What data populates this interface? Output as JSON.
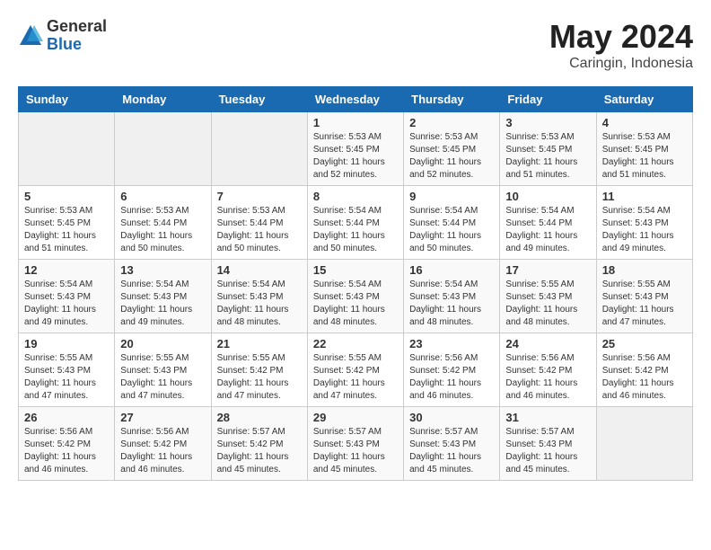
{
  "logo": {
    "general": "General",
    "blue": "Blue"
  },
  "title": "May 2024",
  "location": "Caringin, Indonesia",
  "days_header": [
    "Sunday",
    "Monday",
    "Tuesday",
    "Wednesday",
    "Thursday",
    "Friday",
    "Saturday"
  ],
  "weeks": [
    [
      {
        "day": "",
        "info": ""
      },
      {
        "day": "",
        "info": ""
      },
      {
        "day": "",
        "info": ""
      },
      {
        "day": "1",
        "info": "Sunrise: 5:53 AM\nSunset: 5:45 PM\nDaylight: 11 hours\nand 52 minutes."
      },
      {
        "day": "2",
        "info": "Sunrise: 5:53 AM\nSunset: 5:45 PM\nDaylight: 11 hours\nand 52 minutes."
      },
      {
        "day": "3",
        "info": "Sunrise: 5:53 AM\nSunset: 5:45 PM\nDaylight: 11 hours\nand 51 minutes."
      },
      {
        "day": "4",
        "info": "Sunrise: 5:53 AM\nSunset: 5:45 PM\nDaylight: 11 hours\nand 51 minutes."
      }
    ],
    [
      {
        "day": "5",
        "info": "Sunrise: 5:53 AM\nSunset: 5:45 PM\nDaylight: 11 hours\nand 51 minutes."
      },
      {
        "day": "6",
        "info": "Sunrise: 5:53 AM\nSunset: 5:44 PM\nDaylight: 11 hours\nand 50 minutes."
      },
      {
        "day": "7",
        "info": "Sunrise: 5:53 AM\nSunset: 5:44 PM\nDaylight: 11 hours\nand 50 minutes."
      },
      {
        "day": "8",
        "info": "Sunrise: 5:54 AM\nSunset: 5:44 PM\nDaylight: 11 hours\nand 50 minutes."
      },
      {
        "day": "9",
        "info": "Sunrise: 5:54 AM\nSunset: 5:44 PM\nDaylight: 11 hours\nand 50 minutes."
      },
      {
        "day": "10",
        "info": "Sunrise: 5:54 AM\nSunset: 5:44 PM\nDaylight: 11 hours\nand 49 minutes."
      },
      {
        "day": "11",
        "info": "Sunrise: 5:54 AM\nSunset: 5:43 PM\nDaylight: 11 hours\nand 49 minutes."
      }
    ],
    [
      {
        "day": "12",
        "info": "Sunrise: 5:54 AM\nSunset: 5:43 PM\nDaylight: 11 hours\nand 49 minutes."
      },
      {
        "day": "13",
        "info": "Sunrise: 5:54 AM\nSunset: 5:43 PM\nDaylight: 11 hours\nand 49 minutes."
      },
      {
        "day": "14",
        "info": "Sunrise: 5:54 AM\nSunset: 5:43 PM\nDaylight: 11 hours\nand 48 minutes."
      },
      {
        "day": "15",
        "info": "Sunrise: 5:54 AM\nSunset: 5:43 PM\nDaylight: 11 hours\nand 48 minutes."
      },
      {
        "day": "16",
        "info": "Sunrise: 5:54 AM\nSunset: 5:43 PM\nDaylight: 11 hours\nand 48 minutes."
      },
      {
        "day": "17",
        "info": "Sunrise: 5:55 AM\nSunset: 5:43 PM\nDaylight: 11 hours\nand 48 minutes."
      },
      {
        "day": "18",
        "info": "Sunrise: 5:55 AM\nSunset: 5:43 PM\nDaylight: 11 hours\nand 47 minutes."
      }
    ],
    [
      {
        "day": "19",
        "info": "Sunrise: 5:55 AM\nSunset: 5:43 PM\nDaylight: 11 hours\nand 47 minutes."
      },
      {
        "day": "20",
        "info": "Sunrise: 5:55 AM\nSunset: 5:43 PM\nDaylight: 11 hours\nand 47 minutes."
      },
      {
        "day": "21",
        "info": "Sunrise: 5:55 AM\nSunset: 5:42 PM\nDaylight: 11 hours\nand 47 minutes."
      },
      {
        "day": "22",
        "info": "Sunrise: 5:55 AM\nSunset: 5:42 PM\nDaylight: 11 hours\nand 47 minutes."
      },
      {
        "day": "23",
        "info": "Sunrise: 5:56 AM\nSunset: 5:42 PM\nDaylight: 11 hours\nand 46 minutes."
      },
      {
        "day": "24",
        "info": "Sunrise: 5:56 AM\nSunset: 5:42 PM\nDaylight: 11 hours\nand 46 minutes."
      },
      {
        "day": "25",
        "info": "Sunrise: 5:56 AM\nSunset: 5:42 PM\nDaylight: 11 hours\nand 46 minutes."
      }
    ],
    [
      {
        "day": "26",
        "info": "Sunrise: 5:56 AM\nSunset: 5:42 PM\nDaylight: 11 hours\nand 46 minutes."
      },
      {
        "day": "27",
        "info": "Sunrise: 5:56 AM\nSunset: 5:42 PM\nDaylight: 11 hours\nand 46 minutes."
      },
      {
        "day": "28",
        "info": "Sunrise: 5:57 AM\nSunset: 5:42 PM\nDaylight: 11 hours\nand 45 minutes."
      },
      {
        "day": "29",
        "info": "Sunrise: 5:57 AM\nSunset: 5:43 PM\nDaylight: 11 hours\nand 45 minutes."
      },
      {
        "day": "30",
        "info": "Sunrise: 5:57 AM\nSunset: 5:43 PM\nDaylight: 11 hours\nand 45 minutes."
      },
      {
        "day": "31",
        "info": "Sunrise: 5:57 AM\nSunset: 5:43 PM\nDaylight: 11 hours\nand 45 minutes."
      },
      {
        "day": "",
        "info": ""
      }
    ]
  ]
}
